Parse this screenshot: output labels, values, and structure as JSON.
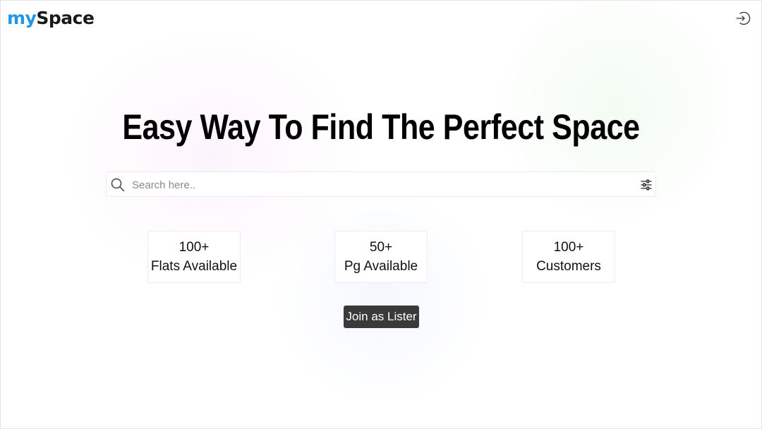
{
  "header": {
    "logo": {
      "part1": "my",
      "part2": "Space"
    },
    "logout_icon": "logout-arrow-icon"
  },
  "hero": {
    "title": "Easy Way To Find The Perfect Space"
  },
  "search": {
    "placeholder": "Search here..",
    "value": "",
    "search_icon": "magnifier-icon",
    "filter_icon": "sliders-icon"
  },
  "stats": [
    {
      "value": "100+",
      "label": "Flats Available"
    },
    {
      "value": "50+",
      "label": "Pg Available"
    },
    {
      "value": "100+",
      "label": "Customers"
    }
  ],
  "cta": {
    "label": "Join as Lister"
  },
  "colors": {
    "brand_blue": "#2196e3",
    "button_bg": "#3a3a3a",
    "text": "#000000"
  }
}
